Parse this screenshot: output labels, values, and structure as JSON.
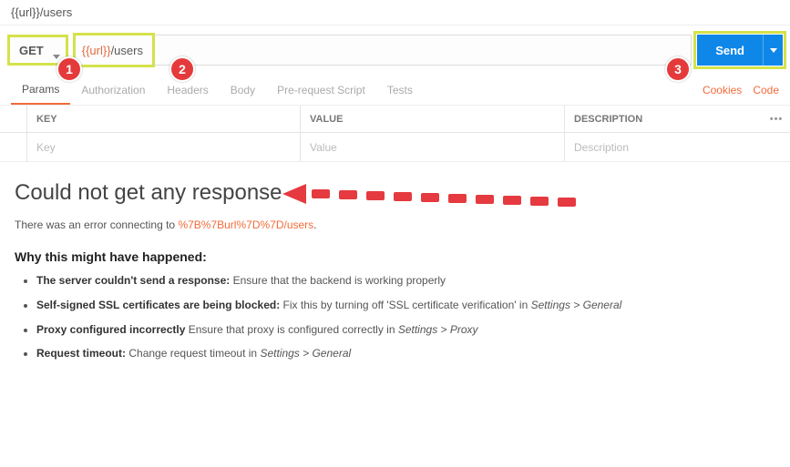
{
  "url_display": "{{url}}/users",
  "request": {
    "method": "GET",
    "url_var": "{{url}}",
    "url_path": "/users",
    "send_label": "Send"
  },
  "tabs": {
    "items": [
      "Params",
      "Authorization",
      "Headers",
      "Body",
      "Pre-request Script",
      "Tests"
    ],
    "active_index": 0,
    "cookies_label": "Cookies",
    "code_label": "Code"
  },
  "kv": {
    "headers": {
      "key": "KEY",
      "value": "VALUE",
      "description": "DESCRIPTION"
    },
    "placeholders": {
      "key": "Key",
      "value": "Value",
      "description": "Description"
    }
  },
  "markers": {
    "m1": "1",
    "m2": "2",
    "m3": "3"
  },
  "response": {
    "title": "Could not get any response",
    "sub_prefix": "There was an error connecting to ",
    "sub_url": "%7B%7Burl%7D%7D/users",
    "sub_suffix": ".",
    "why_title": "Why this might have happened:",
    "reasons": [
      {
        "bold": "The server couldn't send a response:",
        "text": " Ensure that the backend is working properly",
        "italic": ""
      },
      {
        "bold": "Self-signed SSL certificates are being blocked:",
        "text": " Fix this by turning off 'SSL certificate verification' in ",
        "italic": "Settings > General"
      },
      {
        "bold": "Proxy configured incorrectly",
        "text": " Ensure that proxy is configured correctly in ",
        "italic": "Settings > Proxy"
      },
      {
        "bold": "Request timeout:",
        "text": " Change request timeout in ",
        "italic": "Settings > General"
      }
    ]
  }
}
